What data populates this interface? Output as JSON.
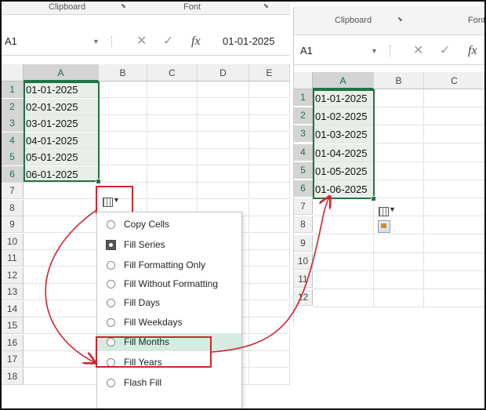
{
  "left": {
    "ribbon": {
      "clipboard": "Clipboard",
      "font": "Font",
      "launcher": "⬊"
    },
    "formula_bar": {
      "name_box": "A1",
      "cancel": "✕",
      "enter": "✓",
      "fx": "fx",
      "value": "01-01-2025"
    },
    "columns": [
      "A",
      "B",
      "C",
      "D",
      "E"
    ],
    "rows": [
      "1",
      "2",
      "3",
      "4",
      "5",
      "6",
      "7",
      "8",
      "9",
      "10",
      "11",
      "12",
      "13",
      "14",
      "15",
      "16",
      "17",
      "18"
    ],
    "cells": [
      "01-01-2025",
      "02-01-2025",
      "03-01-2025",
      "04-01-2025",
      "05-01-2025",
      "06-01-2025"
    ]
  },
  "menu": {
    "items": [
      {
        "label": "Copy Cells",
        "selected": false
      },
      {
        "label": "Fill Series",
        "selected": true
      },
      {
        "label": "Fill Formatting Only",
        "selected": false
      },
      {
        "label": "Fill Without Formatting",
        "selected": false
      },
      {
        "label": "Fill Days",
        "selected": false
      },
      {
        "label": "Fill Weekdays",
        "selected": false
      },
      {
        "label": "Fill Months",
        "selected": false
      },
      {
        "label": "Fill Years",
        "selected": false
      },
      {
        "label": "Flash Fill",
        "selected": false
      }
    ]
  },
  "right": {
    "ribbon": {
      "clipboard": "Clipboard",
      "font": "Font",
      "launcher": "⬊"
    },
    "formula_bar": {
      "name_box": "A1",
      "cancel": "✕",
      "enter": "✓",
      "fx": "fx"
    },
    "columns": [
      "A",
      "B",
      "C"
    ],
    "rows": [
      "1",
      "2",
      "3",
      "4",
      "5",
      "6",
      "7",
      "8",
      "9",
      "10",
      "11",
      "12"
    ],
    "cells": [
      "01-01-2025",
      "01-02-2025",
      "01-03-2025",
      "01-04-2025",
      "01-05-2025",
      "01-06-2025"
    ]
  },
  "colors": {
    "excel_green": "#217346",
    "annotation_red": "#d3232f",
    "highlight": "#d7ece0"
  }
}
